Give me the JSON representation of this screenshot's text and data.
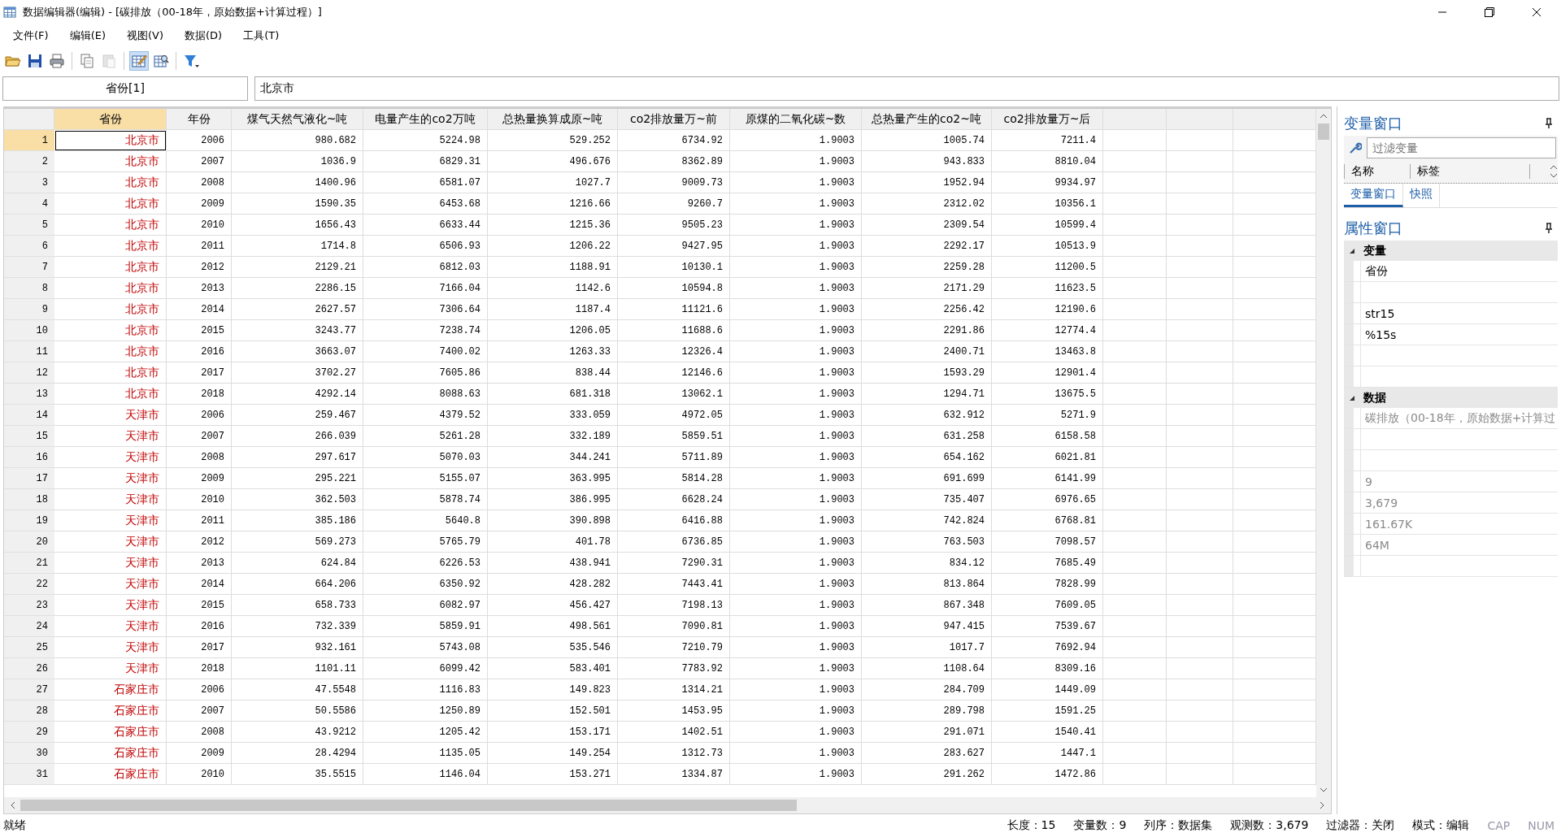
{
  "window": {
    "title": "数据编辑器(编辑) - [碳排放（00-18年，原始数据+计算过程）]"
  },
  "menu": [
    "文件(F)",
    "编辑(E)",
    "视图(V)",
    "数据(D)",
    "工具(T)"
  ],
  "toolbar": [
    {
      "kind": "open",
      "selected": false,
      "disabled": false
    },
    {
      "kind": "save",
      "selected": false,
      "disabled": false
    },
    {
      "kind": "print",
      "selected": false,
      "disabled": false
    },
    {
      "kind": "sep"
    },
    {
      "kind": "copy",
      "selected": false,
      "disabled": false
    },
    {
      "kind": "paste",
      "selected": false,
      "disabled": true
    },
    {
      "kind": "sep"
    },
    {
      "kind": "edit",
      "selected": true,
      "disabled": false
    },
    {
      "kind": "browse",
      "selected": false,
      "disabled": false
    },
    {
      "kind": "sep"
    },
    {
      "kind": "filter",
      "selected": false,
      "disabled": false
    }
  ],
  "cell_bar": {
    "name": "省份[1]",
    "value": "北京市"
  },
  "table": {
    "columns": [
      {
        "label": "省份",
        "selected": true
      },
      {
        "label": "年份",
        "selected": false
      },
      {
        "label": "煤气天然气液化~吨",
        "selected": false
      },
      {
        "label": "电量产生的co2万吨",
        "selected": false
      },
      {
        "label": "总热量换算成原~吨",
        "selected": false
      },
      {
        "label": "co2排放量万~前",
        "selected": false
      },
      {
        "label": "原煤的二氧化碳~数",
        "selected": false
      },
      {
        "label": "总热量产生的co2~吨",
        "selected": false
      },
      {
        "label": "co2排放量万~后",
        "selected": false
      }
    ],
    "rows": [
      {
        "n": "1",
        "selected": true,
        "cells": [
          "北京市",
          "2006",
          "980.682",
          "5224.98",
          "529.252",
          "6734.92",
          "1.9003",
          "1005.74",
          "7211.4"
        ]
      },
      {
        "n": "2",
        "selected": false,
        "cells": [
          "北京市",
          "2007",
          "1036.9",
          "6829.31",
          "496.676",
          "8362.89",
          "1.9003",
          "943.833",
          "8810.04"
        ]
      },
      {
        "n": "3",
        "selected": false,
        "cells": [
          "北京市",
          "2008",
          "1400.96",
          "6581.07",
          "1027.7",
          "9009.73",
          "1.9003",
          "1952.94",
          "9934.97"
        ]
      },
      {
        "n": "4",
        "selected": false,
        "cells": [
          "北京市",
          "2009",
          "1590.35",
          "6453.68",
          "1216.66",
          "9260.7",
          "1.9003",
          "2312.02",
          "10356.1"
        ]
      },
      {
        "n": "5",
        "selected": false,
        "cells": [
          "北京市",
          "2010",
          "1656.43",
          "6633.44",
          "1215.36",
          "9505.23",
          "1.9003",
          "2309.54",
          "10599.4"
        ]
      },
      {
        "n": "6",
        "selected": false,
        "cells": [
          "北京市",
          "2011",
          "1714.8",
          "6506.93",
          "1206.22",
          "9427.95",
          "1.9003",
          "2292.17",
          "10513.9"
        ]
      },
      {
        "n": "7",
        "selected": false,
        "cells": [
          "北京市",
          "2012",
          "2129.21",
          "6812.03",
          "1188.91",
          "10130.1",
          "1.9003",
          "2259.28",
          "11200.5"
        ]
      },
      {
        "n": "8",
        "selected": false,
        "cells": [
          "北京市",
          "2013",
          "2286.15",
          "7166.04",
          "1142.6",
          "10594.8",
          "1.9003",
          "2171.29",
          "11623.5"
        ]
      },
      {
        "n": "9",
        "selected": false,
        "cells": [
          "北京市",
          "2014",
          "2627.57",
          "7306.64",
          "1187.4",
          "11121.6",
          "1.9003",
          "2256.42",
          "12190.6"
        ]
      },
      {
        "n": "10",
        "selected": false,
        "cells": [
          "北京市",
          "2015",
          "3243.77",
          "7238.74",
          "1206.05",
          "11688.6",
          "1.9003",
          "2291.86",
          "12774.4"
        ]
      },
      {
        "n": "11",
        "selected": false,
        "cells": [
          "北京市",
          "2016",
          "3663.07",
          "7400.02",
          "1263.33",
          "12326.4",
          "1.9003",
          "2400.71",
          "13463.8"
        ]
      },
      {
        "n": "12",
        "selected": false,
        "cells": [
          "北京市",
          "2017",
          "3702.27",
          "7605.86",
          "838.44",
          "12146.6",
          "1.9003",
          "1593.29",
          "12901.4"
        ]
      },
      {
        "n": "13",
        "selected": false,
        "cells": [
          "北京市",
          "2018",
          "4292.14",
          "8088.63",
          "681.318",
          "13062.1",
          "1.9003",
          "1294.71",
          "13675.5"
        ]
      },
      {
        "n": "14",
        "selected": false,
        "cells": [
          "天津市",
          "2006",
          "259.467",
          "4379.52",
          "333.059",
          "4972.05",
          "1.9003",
          "632.912",
          "5271.9"
        ]
      },
      {
        "n": "15",
        "selected": false,
        "cells": [
          "天津市",
          "2007",
          "266.039",
          "5261.28",
          "332.189",
          "5859.51",
          "1.9003",
          "631.258",
          "6158.58"
        ]
      },
      {
        "n": "16",
        "selected": false,
        "cells": [
          "天津市",
          "2008",
          "297.617",
          "5070.03",
          "344.241",
          "5711.89",
          "1.9003",
          "654.162",
          "6021.81"
        ]
      },
      {
        "n": "17",
        "selected": false,
        "cells": [
          "天津市",
          "2009",
          "295.221",
          "5155.07",
          "363.995",
          "5814.28",
          "1.9003",
          "691.699",
          "6141.99"
        ]
      },
      {
        "n": "18",
        "selected": false,
        "cells": [
          "天津市",
          "2010",
          "362.503",
          "5878.74",
          "386.995",
          "6628.24",
          "1.9003",
          "735.407",
          "6976.65"
        ]
      },
      {
        "n": "19",
        "selected": false,
        "cells": [
          "天津市",
          "2011",
          "385.186",
          "5640.8",
          "390.898",
          "6416.88",
          "1.9003",
          "742.824",
          "6768.81"
        ]
      },
      {
        "n": "20",
        "selected": false,
        "cells": [
          "天津市",
          "2012",
          "569.273",
          "5765.79",
          "401.78",
          "6736.85",
          "1.9003",
          "763.503",
          "7098.57"
        ]
      },
      {
        "n": "21",
        "selected": false,
        "cells": [
          "天津市",
          "2013",
          "624.84",
          "6226.53",
          "438.941",
          "7290.31",
          "1.9003",
          "834.12",
          "7685.49"
        ]
      },
      {
        "n": "22",
        "selected": false,
        "cells": [
          "天津市",
          "2014",
          "664.206",
          "6350.92",
          "428.282",
          "7443.41",
          "1.9003",
          "813.864",
          "7828.99"
        ]
      },
      {
        "n": "23",
        "selected": false,
        "cells": [
          "天津市",
          "2015",
          "658.733",
          "6082.97",
          "456.427",
          "7198.13",
          "1.9003",
          "867.348",
          "7609.05"
        ]
      },
      {
        "n": "24",
        "selected": false,
        "cells": [
          "天津市",
          "2016",
          "732.339",
          "5859.91",
          "498.561",
          "7090.81",
          "1.9003",
          "947.415",
          "7539.67"
        ]
      },
      {
        "n": "25",
        "selected": false,
        "cells": [
          "天津市",
          "2017",
          "932.161",
          "5743.08",
          "535.546",
          "7210.79",
          "1.9003",
          "1017.7",
          "7692.94"
        ]
      },
      {
        "n": "26",
        "selected": false,
        "cells": [
          "天津市",
          "2018",
          "1101.11",
          "6099.42",
          "583.401",
          "7783.92",
          "1.9003",
          "1108.64",
          "8309.16"
        ]
      },
      {
        "n": "27",
        "selected": false,
        "cells": [
          "石家庄市",
          "2006",
          "47.5548",
          "1116.83",
          "149.823",
          "1314.21",
          "1.9003",
          "284.709",
          "1449.09"
        ]
      },
      {
        "n": "28",
        "selected": false,
        "cells": [
          "石家庄市",
          "2007",
          "50.5586",
          "1250.89",
          "152.501",
          "1453.95",
          "1.9003",
          "289.798",
          "1591.25"
        ]
      },
      {
        "n": "29",
        "selected": false,
        "cells": [
          "石家庄市",
          "2008",
          "43.9212",
          "1205.42",
          "153.171",
          "1402.51",
          "1.9003",
          "291.071",
          "1540.41"
        ]
      },
      {
        "n": "30",
        "selected": false,
        "cells": [
          "石家庄市",
          "2009",
          "28.4294",
          "1135.05",
          "149.254",
          "1312.73",
          "1.9003",
          "283.627",
          "1447.1"
        ]
      },
      {
        "n": "31",
        "selected": false,
        "cells": [
          "石家庄市",
          "2010",
          "35.5515",
          "1146.04",
          "153.271",
          "1334.87",
          "1.9003",
          "291.262",
          "1472.86"
        ]
      }
    ]
  },
  "variables_window": {
    "title": "变量窗口",
    "filter": {
      "placeholder": "过滤变量"
    },
    "columns": [
      "名称",
      "标签"
    ],
    "tabs": [
      {
        "label": "变量窗口",
        "selected": true
      },
      {
        "label": "快照",
        "selected": false
      }
    ]
  },
  "properties_window": {
    "title": "属性窗口",
    "sections": [
      {
        "title": "变量",
        "expanded": true,
        "rows": [
          {
            "value": "省份",
            "disabled": false
          },
          {},
          {
            "value": "str15",
            "disabled": false
          },
          {
            "value": "%15s",
            "disabled": false
          },
          {},
          {}
        ]
      },
      {
        "title": "数据",
        "expanded": true,
        "rows": [
          {
            "value": "碳排放（00-18年，原始数据+计算过",
            "disabled": true
          },
          {},
          {},
          {
            "value": "9",
            "disabled": true
          },
          {
            "value": "3,679",
            "disabled": true
          },
          {
            "value": "161.67K",
            "disabled": true
          },
          {
            "value": "64M",
            "disabled": true
          },
          {}
        ]
      }
    ]
  },
  "status_bar": {
    "message": "就绪",
    "fields": [
      {
        "text": "长度：15",
        "on": true
      },
      {
        "text": "变量数：9",
        "on": true
      },
      {
        "text": "列序：数据集",
        "on": true
      },
      {
        "text": "观测数：3,679",
        "on": true
      },
      {
        "text": "过滤器：关闭",
        "on": true
      },
      {
        "text": "模式：编辑",
        "on": true
      },
      {
        "text": "CAP",
        "on": false
      },
      {
        "text": "NUM",
        "on": false
      }
    ]
  }
}
